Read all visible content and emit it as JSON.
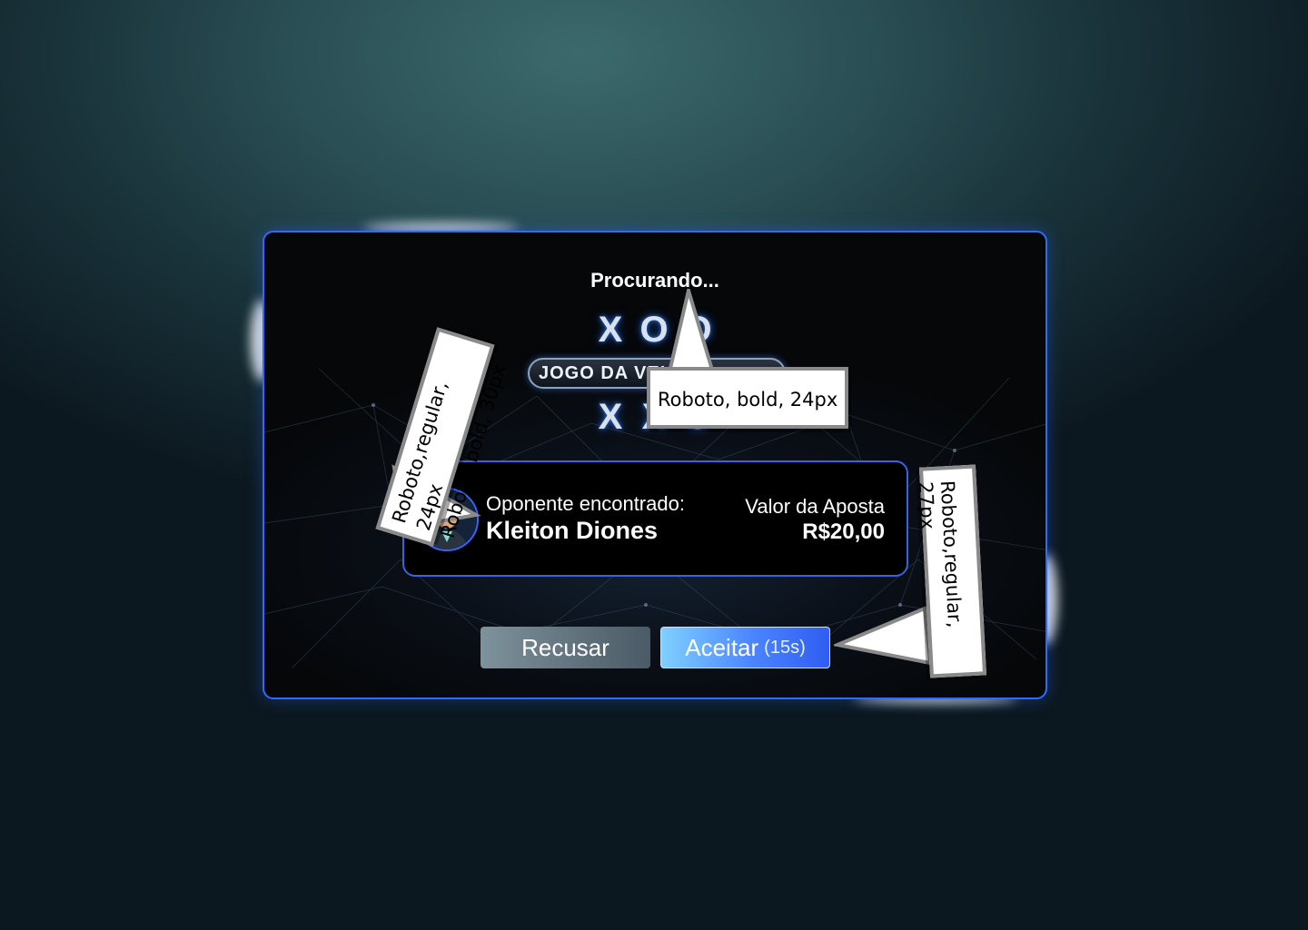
{
  "modal": {
    "status_title": "Procurando...",
    "logo": {
      "top_row": [
        "X",
        "O",
        "O"
      ],
      "banner_text": "JOGO DA VELHA",
      "bottom_row": [
        "X",
        "X",
        "O"
      ]
    },
    "opponent": {
      "label": "Oponente encontrado:",
      "name": "Kleiton Diones"
    },
    "bet": {
      "label": "Valor da Aposta",
      "value": "R$20,00"
    },
    "buttons": {
      "decline_label": "Recusar",
      "accept_label": "Aceitar",
      "accept_timer": "(15s)"
    }
  },
  "annotations": {
    "title_spec": "Roboto, bold, 24px",
    "opponent_spec_line1": "Roboto,regular, 24px",
    "opponent_spec_line2": "Roboto, bold, 30px",
    "bet_spec": "Roboto,regular, 27px"
  },
  "colors": {
    "modal_border": "#2d6bff",
    "accept_gradient_start": "#7fd0ff",
    "accept_gradient_end": "#2f5df0",
    "decline_gradient_start": "#7e929b",
    "decline_gradient_end": "#4a5a66"
  }
}
